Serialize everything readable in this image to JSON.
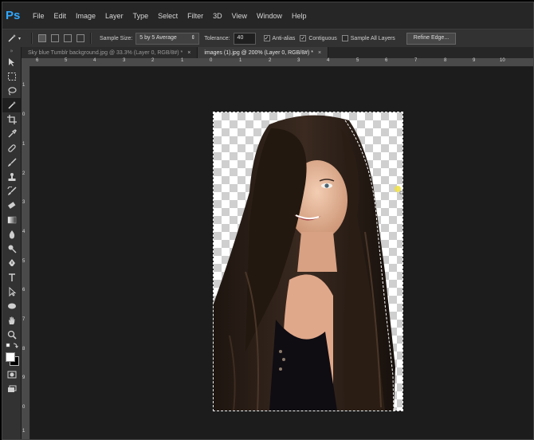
{
  "app": {
    "logo_text": "Ps"
  },
  "menu": [
    "File",
    "Edit",
    "Image",
    "Layer",
    "Type",
    "Select",
    "Filter",
    "3D",
    "View",
    "Window",
    "Help"
  ],
  "options": {
    "sample_size_label": "Sample Size:",
    "sample_size_value": "5 by 5 Average",
    "tolerance_label": "Tolerance:",
    "tolerance_value": "40",
    "anti_alias_label": "Anti-alias",
    "contiguous_label": "Contiguous",
    "sample_all_layers_label": "Sample All Layers",
    "refine_edge_label": "Refine Edge..."
  },
  "tabs": [
    {
      "label": "Sky blue Tumblr background.jpg @ 33.3% (Layer 0, RGB/8#) *",
      "close": "×"
    },
    {
      "label": "images (1).jpg @ 200% (Layer 0, RGB/8#) *",
      "close": "×"
    }
  ],
  "ruler_top_labels": [
    "6",
    "5",
    "4",
    "3",
    "2",
    "1",
    "0",
    "1",
    "2",
    "3",
    "4",
    "5",
    "6",
    "7",
    "8",
    "9",
    "10"
  ],
  "ruler_left_labels": [
    "1",
    "0",
    "1",
    "2",
    "3",
    "4",
    "5",
    "6",
    "7",
    "8",
    "9",
    "0",
    "1"
  ],
  "toolbar": {
    "grip": "»"
  }
}
